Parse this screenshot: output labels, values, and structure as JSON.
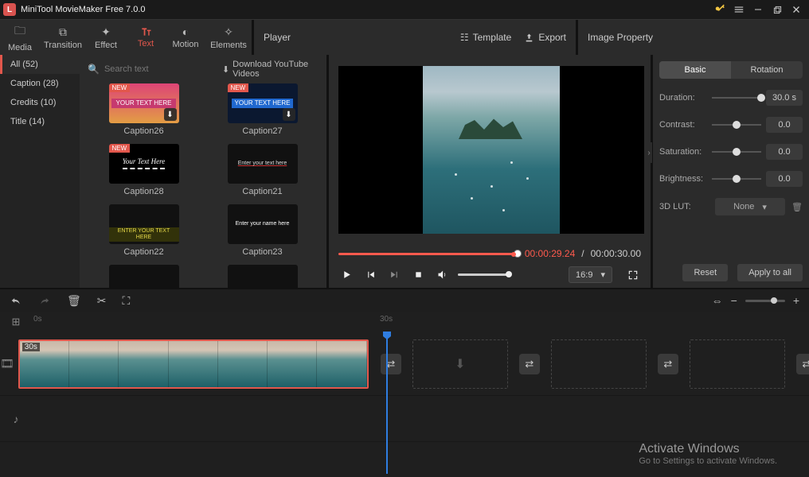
{
  "titlebar": {
    "title": "MiniTool MovieMaker Free 7.0.0"
  },
  "tabs": {
    "media": "Media",
    "transition": "Transition",
    "effect": "Effect",
    "text": "Text",
    "motion": "Motion",
    "elements": "Elements"
  },
  "header": {
    "player": "Player",
    "template": "Template",
    "export": "Export",
    "image_property": "Image Property"
  },
  "categories": {
    "all": "All (52)",
    "caption": "Caption (28)",
    "credits": "Credits (10)",
    "title": "Title (14)"
  },
  "search": {
    "placeholder": "Search text"
  },
  "download_link": "Download YouTube Videos",
  "thumbs": {
    "new": "NEW",
    "c26": {
      "label": "Caption26",
      "text": "YOUR TEXT HERE"
    },
    "c27": {
      "label": "Caption27",
      "text": "YOUR TEXT HERE"
    },
    "c28": {
      "label": "Caption28",
      "text": "Your Text Here"
    },
    "c21": {
      "label": "Caption21",
      "text": "Enter your text here"
    },
    "c22": {
      "label": "Caption22",
      "text": "ENTER YOUR TEXT HERE"
    },
    "c23": {
      "label": "Caption23",
      "text": "Enter your name here"
    }
  },
  "player": {
    "current": "00:00:29.24",
    "duration": "00:00:30.00",
    "ratio": "16:9"
  },
  "props": {
    "tab_basic": "Basic",
    "tab_rotation": "Rotation",
    "duration_label": "Duration:",
    "duration_value": "30.0 s",
    "contrast_label": "Contrast:",
    "contrast_value": "0.0",
    "saturation_label": "Saturation:",
    "saturation_value": "0.0",
    "brightness_label": "Brightness:",
    "brightness_value": "0.0",
    "lut_label": "3D LUT:",
    "lut_value": "None",
    "reset": "Reset",
    "apply": "Apply to all"
  },
  "ruler": {
    "t0": "0s",
    "t30": "30s"
  },
  "clip": {
    "duration": "30s"
  },
  "watermark": {
    "line1": "Activate Windows",
    "line2": "Go to Settings to activate Windows."
  }
}
